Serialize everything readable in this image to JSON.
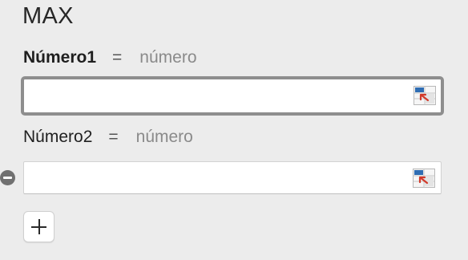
{
  "function": {
    "name": "MAX"
  },
  "arguments": [
    {
      "name": "Número1",
      "equals": "=",
      "type": "número",
      "value": "",
      "active": true
    },
    {
      "name": "Número2",
      "equals": "=",
      "type": "número",
      "value": "",
      "active": false
    }
  ],
  "icons": {
    "range_select": "range-select-icon",
    "remove_argument": "minus-circle-icon",
    "add_argument": "plus-icon"
  },
  "colors": {
    "background": "#ececec",
    "active_border": "#8e8e8e",
    "ref_icon_blue": "#2f6db3",
    "ref_icon_red": "#d23a2a"
  }
}
